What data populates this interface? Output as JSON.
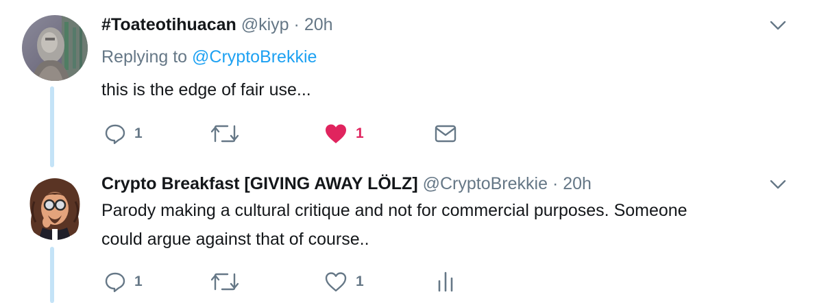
{
  "tweets": [
    {
      "display_name": "#Toateotihuacan",
      "handle": "@kiyp",
      "separator": "·",
      "time": "20h",
      "replying_prefix": "Replying to",
      "replying_to": "@CryptoBrekkie",
      "text_lines": [
        "this is the edge of fair use..."
      ],
      "reply_count": "1",
      "retweet_count": "",
      "like_count": "1",
      "liked": true,
      "last_action_icon": "envelope-icon"
    },
    {
      "display_name": "Crypto Breakfast [GIVING AWAY LÖLZ]",
      "handle": "@CryptoBrekkie",
      "separator": "·",
      "time": "20h",
      "text_lines": [
        "Parody making a cultural critique and not for commercial purposes. Someone",
        "could argue against that of course.."
      ],
      "reply_count": "1",
      "retweet_count": "",
      "like_count": "1",
      "liked": false,
      "last_action_icon": "analytics-icon"
    }
  ],
  "colors": {
    "text": "#14171a",
    "secondary": "#657786",
    "link": "#1da1f2",
    "like": "#e0245e",
    "thread_line": "#c4e3f7"
  }
}
